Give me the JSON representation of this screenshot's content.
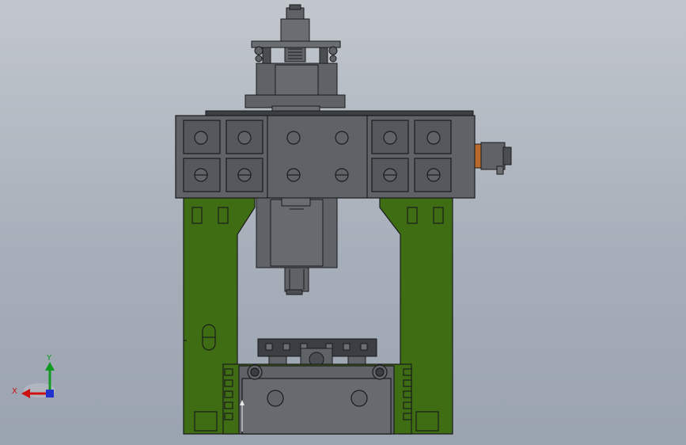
{
  "viewport": {
    "colors": {
      "machine_gray": "#5f6368",
      "machine_dark": "#3b3e42",
      "frame_green": "#3f6d14",
      "edge": "#1b1b1b",
      "motor_orange": "#b7682a",
      "axis_x": "#cc1111",
      "axis_y": "#119922",
      "axis_z": "#2233cc"
    }
  },
  "triad": {
    "x_label": "X",
    "y_label": "Y"
  }
}
